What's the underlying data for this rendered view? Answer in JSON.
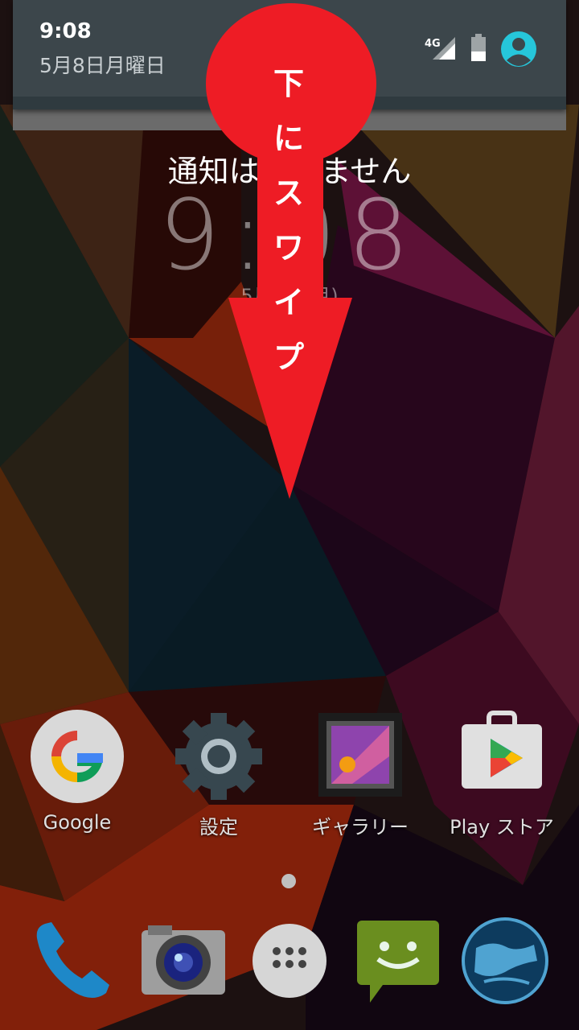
{
  "status": {
    "time": "9:08",
    "date": "5月8日月曜日",
    "network": "4G"
  },
  "lockscreen": {
    "notification_text": "通知はありません",
    "clock": "9:08",
    "date": "5月8日(月)"
  },
  "overlay": {
    "instruction_chars": [
      "下",
      "に",
      "ス",
      "ワ",
      "イ",
      "プ"
    ],
    "color": "#ee1c25"
  },
  "apps": [
    {
      "label": "Google",
      "icon": "google-icon"
    },
    {
      "label": "設定",
      "icon": "settings-gear-icon"
    },
    {
      "label": "ギャラリー",
      "icon": "gallery-icon"
    },
    {
      "label": "Play ストア",
      "icon": "play-store-icon"
    }
  ],
  "dock": [
    "phone-icon",
    "camera-icon",
    "app-drawer-icon",
    "messaging-icon",
    "browser-globe-icon"
  ],
  "colors": {
    "shade": "#3c464b",
    "accent": "#26c6da"
  }
}
